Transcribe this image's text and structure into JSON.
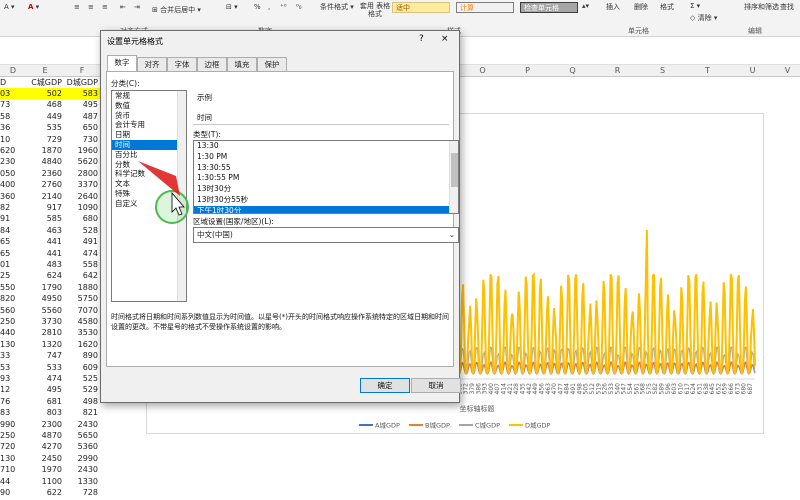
{
  "ribbon": {
    "merge_label": "合并后居中",
    "align_group": "对齐方式",
    "number_group": "数字",
    "cond_format": "条件格式",
    "table_format": "套用 表格格式",
    "style_medium": "适中",
    "style_calc": "计算",
    "style_check": "检查单元格",
    "styles_group": "样式",
    "insert": "插入",
    "delete": "删除",
    "format": "格式",
    "cells_group": "单元格",
    "clear": "清除",
    "sort_filter": "排序和筛选",
    "find": "查找",
    "edit_group": "编辑",
    "percent": "%",
    "comma": ","
  },
  "columns": [
    "D",
    "E",
    "F",
    "O",
    "P",
    "Q",
    "R",
    "S",
    "T",
    "U",
    "V"
  ],
  "header_row": [
    "D",
    "C城GDP",
    "D城GDP"
  ],
  "rows": [
    [
      "03",
      "502",
      "583"
    ],
    [
      "73",
      "468",
      "495"
    ],
    [
      "58",
      "449",
      "487"
    ],
    [
      "36",
      "535",
      "650"
    ],
    [
      "10",
      "729",
      "730"
    ],
    [
      "620",
      "1870",
      "1960"
    ],
    [
      "230",
      "4840",
      "5620"
    ],
    [
      "050",
      "2360",
      "2800"
    ],
    [
      "400",
      "2760",
      "3370"
    ],
    [
      "360",
      "2140",
      "2640"
    ],
    [
      "82",
      "917",
      "1090"
    ],
    [
      "91",
      "585",
      "680"
    ],
    [
      "84",
      "463",
      "528"
    ],
    [
      "65",
      "441",
      "491"
    ],
    [
      "65",
      "441",
      "474"
    ],
    [
      "01",
      "483",
      "558"
    ],
    [
      "25",
      "624",
      "642"
    ],
    [
      "550",
      "1790",
      "1880"
    ],
    [
      "820",
      "4950",
      "5750"
    ],
    [
      "560",
      "5560",
      "7070"
    ],
    [
      "250",
      "3730",
      "4580"
    ],
    [
      "440",
      "2810",
      "3530"
    ],
    [
      "130",
      "1320",
      "1620"
    ],
    [
      "33",
      "747",
      "890"
    ],
    [
      "53",
      "533",
      "609"
    ],
    [
      "93",
      "474",
      "525"
    ],
    [
      "12",
      "495",
      "529"
    ],
    [
      "76",
      "681",
      "498"
    ],
    [
      "83",
      "803",
      "821"
    ],
    [
      "990",
      "2300",
      "2430"
    ],
    [
      "250",
      "4870",
      "5650"
    ],
    [
      "720",
      "4270",
      "5360"
    ],
    [
      "130",
      "2450",
      "2990"
    ],
    [
      "710",
      "1970",
      "2430"
    ],
    [
      "44",
      "1100",
      "1330"
    ],
    [
      "90",
      "622",
      "728"
    ]
  ],
  "chart_data": {
    "type": "line",
    "title": "",
    "xlabel": "坐标轴标题",
    "ylabel": "",
    "x_ticks": [
      "358",
      "365",
      "372",
      "379",
      "386",
      "393",
      "400",
      "407",
      "414",
      "421",
      "428",
      "435",
      "442",
      "449",
      "456",
      "463",
      "470",
      "477",
      "484",
      "491",
      "498",
      "505",
      "512",
      "519",
      "526",
      "533",
      "540",
      "547",
      "554",
      "561",
      "568",
      "575",
      "582",
      "589",
      "596",
      "603",
      "610",
      "617",
      "624",
      "631",
      "638",
      "645",
      "652",
      "659",
      "666",
      "673",
      "680",
      "687"
    ],
    "series": [
      {
        "name": "A城GDP",
        "color": "#4472c4"
      },
      {
        "name": "B城GDP",
        "color": "#ed7d31"
      },
      {
        "name": "C城GDP",
        "color": "#a5a5a5"
      },
      {
        "name": "D城GDP",
        "color": "#ffc000"
      }
    ],
    "legend_position": "bottom"
  },
  "dialog": {
    "title": "设置单元格格式",
    "help": "?",
    "close": "×",
    "tabs": [
      "数字",
      "对齐",
      "字体",
      "边框",
      "填充",
      "保护"
    ],
    "category_label": "分类(C):",
    "categories": [
      "常规",
      "数值",
      "货币",
      "会计专用",
      "日期",
      "时间",
      "百分比",
      "分数",
      "科学记数",
      "文本",
      "特殊",
      "自定义"
    ],
    "selected_category": "时间",
    "sample_label": "示例",
    "sample_value": "时间",
    "type_label": "类型(T):",
    "types": [
      "13:30",
      "1:30 PM",
      "13:30:55",
      "1:30:55 PM",
      "13时30分",
      "13时30分55秒",
      "下午1时30分"
    ],
    "selected_type": "下午1时30分",
    "locale_label": "区域设置(国家/地区)(L):",
    "locale_value": "中文(中国)",
    "description": "时间格式将日期和时间系列数值显示为时间值。以星号(*)开头的时间格式响应操作系统特定的区域日期和时间设置的更改。不带星号的格式不受操作系统设置的影响。",
    "ok": "确定",
    "cancel": "取消"
  }
}
